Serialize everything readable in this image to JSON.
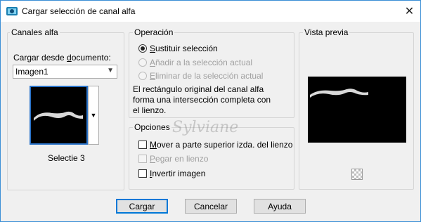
{
  "window": {
    "title": "Cargar selección de canal alfa",
    "close_symbol": "✕"
  },
  "channels": {
    "group_label": "Canales alfa",
    "load_label": "Cargar desde documento:",
    "document_value": "Imagen1",
    "thumbnail_caption": "Selectie 3"
  },
  "operation": {
    "group_label": "Operación",
    "options": [
      {
        "label": "Sustituir selección",
        "selected": true,
        "enabled": true
      },
      {
        "label": "Añadir a la selección actual",
        "selected": false,
        "enabled": false
      },
      {
        "label": "Eliminar de la selección actual",
        "selected": false,
        "enabled": false
      }
    ],
    "description": "El rectángulo original del canal alfa forma una intersección completa con el lienzo."
  },
  "options": {
    "group_label": "Opciones",
    "items": [
      {
        "label": "Mover a parte superior izda. del lienzo",
        "checked": false,
        "enabled": true
      },
      {
        "label": "Pegar en lienzo",
        "checked": false,
        "enabled": false
      },
      {
        "label": "Invertir imagen",
        "checked": false,
        "enabled": true
      }
    ]
  },
  "preview": {
    "group_label": "Vista previa"
  },
  "buttons": {
    "load": "Cargar",
    "cancel": "Cancelar",
    "help": "Ayuda"
  },
  "watermark": "Sylviane",
  "colors": {
    "accent": "#0078d7",
    "window_border": "#3b8fd6",
    "background": "#f0f0f0"
  }
}
